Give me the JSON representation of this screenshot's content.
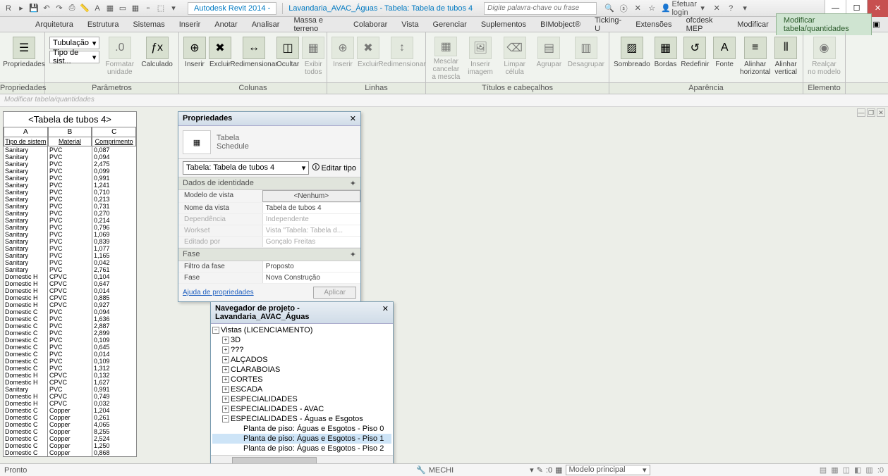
{
  "titlebar": {
    "app": "Autodesk Revit 2014 -",
    "doc": "Lavandaria_AVAC_Águas - Tabela: Tabela de tubos 4",
    "search_placeholder": "Digite palavra-chave ou frase",
    "login": "Efetuar login"
  },
  "menu": {
    "tabs": [
      "Arquitetura",
      "Estrutura",
      "Sistemas",
      "Inserir",
      "Anotar",
      "Analisar",
      "Massa e terreno",
      "Colaborar",
      "Vista",
      "Gerenciar",
      "Suplementos",
      "BIMobject®",
      "Ticking-U",
      "Extensões",
      "ofcdesk MEP",
      "Modificar",
      "Modificar tabela/quantidades"
    ],
    "active": 16
  },
  "ribbon": {
    "props": "Propriedades",
    "combo1": "Tubulação",
    "combo2": "Tipo de sist...",
    "buttons": [
      "Formatar unidade",
      "Calculado",
      "Inserir",
      "Excluir",
      "Redimensionar",
      "Ocultar",
      "Exibir todos",
      "Inserir",
      "Excluir",
      "Redimensionar",
      "Mesclar cancelar a mescla",
      "Inserir imagem",
      "Limpar célula",
      "Agrupar",
      "Desagrupar",
      "Sombreado",
      "Bordas",
      "Redefinir",
      "Fonte",
      "Alinhar horizontal",
      "Alinhar vertical",
      "Realçar no modelo"
    ],
    "groups": [
      "Propriedades",
      "Parâmetros",
      "Colunas",
      "Linhas",
      "Títulos e cabeçalhos",
      "Aparência",
      "Elemento"
    ]
  },
  "secbar": "Modificar tabela/quantidades",
  "schedule": {
    "title": "<Tabela de tubos 4>",
    "cols": [
      "A",
      "B",
      "C"
    ],
    "headers": [
      "Tipo de sistem",
      "Material",
      "Comprimento"
    ],
    "rows": [
      [
        "Sanitary",
        "PVC",
        "0,087"
      ],
      [
        "Sanitary",
        "PVC",
        "0,094"
      ],
      [
        "Sanitary",
        "PVC",
        "2,475"
      ],
      [
        "Sanitary",
        "PVC",
        "0,099"
      ],
      [
        "Sanitary",
        "PVC",
        "0,991"
      ],
      [
        "Sanitary",
        "PVC",
        "1,241"
      ],
      [
        "Sanitary",
        "PVC",
        "0,710"
      ],
      [
        "Sanitary",
        "PVC",
        "0,213"
      ],
      [
        "Sanitary",
        "PVC",
        "0,731"
      ],
      [
        "Sanitary",
        "PVC",
        "0,270"
      ],
      [
        "Sanitary",
        "PVC",
        "0,214"
      ],
      [
        "Sanitary",
        "PVC",
        "0,796"
      ],
      [
        "Sanitary",
        "PVC",
        "1,069"
      ],
      [
        "Sanitary",
        "PVC",
        "0,839"
      ],
      [
        "Sanitary",
        "PVC",
        "1,077"
      ],
      [
        "Sanitary",
        "PVC",
        "1,165"
      ],
      [
        "Sanitary",
        "PVC",
        "0,042"
      ],
      [
        "Sanitary",
        "PVC",
        "2,761"
      ],
      [
        "Domestic H",
        "CPVC",
        "0,104"
      ],
      [
        "Domestic H",
        "CPVC",
        "0,647"
      ],
      [
        "Domestic H",
        "CPVC",
        "0,014"
      ],
      [
        "Domestic H",
        "CPVC",
        "0,885"
      ],
      [
        "Domestic H",
        "CPVC",
        "0,927"
      ],
      [
        "Domestic C",
        "PVC",
        "0,094"
      ],
      [
        "Domestic C",
        "PVC",
        "1,636"
      ],
      [
        "Domestic C",
        "PVC",
        "2,887"
      ],
      [
        "Domestic C",
        "PVC",
        "2,899"
      ],
      [
        "Domestic C",
        "PVC",
        "0,109"
      ],
      [
        "Domestic C",
        "PVC",
        "0,645"
      ],
      [
        "Domestic C",
        "PVC",
        "0,014"
      ],
      [
        "Domestic C",
        "PVC",
        "0,109"
      ],
      [
        "Domestic C",
        "PVC",
        "1,312"
      ],
      [
        "Domestic H",
        "CPVC",
        "0,132"
      ],
      [
        "Domestic H",
        "CPVC",
        "1,627"
      ],
      [
        "Sanitary",
        "PVC",
        "0,991"
      ],
      [
        "Domestic H",
        "CPVC",
        "0,749"
      ],
      [
        "Domestic H",
        "CPVC",
        "0,032"
      ],
      [
        "Domestic C",
        "Copper",
        "1,204"
      ],
      [
        "Domestic C",
        "Copper",
        "0,261"
      ],
      [
        "Domestic C",
        "Copper",
        "4,065"
      ],
      [
        "Domestic C",
        "Copper",
        "8,255"
      ],
      [
        "Domestic C",
        "Copper",
        "2,524"
      ],
      [
        "Domestic C",
        "Copper",
        "1,250"
      ],
      [
        "Domestic C",
        "Copper",
        "0,868"
      ]
    ]
  },
  "props": {
    "title": "Propriedades",
    "type1": "Tabela",
    "type2": "Schedule",
    "selector": "Tabela: Tabela de tubos 4",
    "edit_type": "Editar tipo",
    "sec1": "Dados de identidade",
    "rows1": [
      {
        "k": "Modelo de vista",
        "v": "<Nenhum>",
        "btn": true
      },
      {
        "k": "Nome da vista",
        "v": "Tabela de tubos 4"
      },
      {
        "k": "Dependência",
        "v": "Independente",
        "gray": true
      },
      {
        "k": "Workset",
        "v": "Vista \"Tabela: Tabela d...",
        "gray": true
      },
      {
        "k": "Editado por",
        "v": "Gonçalo Freitas",
        "gray": true
      }
    ],
    "sec2": "Fase",
    "rows2": [
      {
        "k": "Filtro da fase",
        "v": "Proposto"
      },
      {
        "k": "Fase",
        "v": "Nova Construção"
      }
    ],
    "help": "Ajuda de propriedades",
    "apply": "Aplicar"
  },
  "browser": {
    "title": "Navegador de projeto - Lavandaria_AVAC_Águas",
    "root": "Vistas (LICENCIAMENTO)",
    "nodes": [
      "3D",
      "???",
      "ALÇADOS",
      "CLARABOIAS",
      "CORTES",
      "ESCADA",
      "ESPECIALIDADES",
      "ESPECIALIDADES - AVAC",
      "ESPECIALIDADES - Águas e Esgotos"
    ],
    "leaves": [
      "Planta de piso: Águas e Esgotos - Piso 0",
      "Planta de piso: Águas e Esgotos - Piso 1",
      "Planta de piso: Águas e Esgotos - Piso 2"
    ],
    "selected": 1
  },
  "status": {
    "left": "Pronto",
    "center_label": "MECHI",
    "combo2": "Modelo principal",
    "zero": ":0"
  }
}
